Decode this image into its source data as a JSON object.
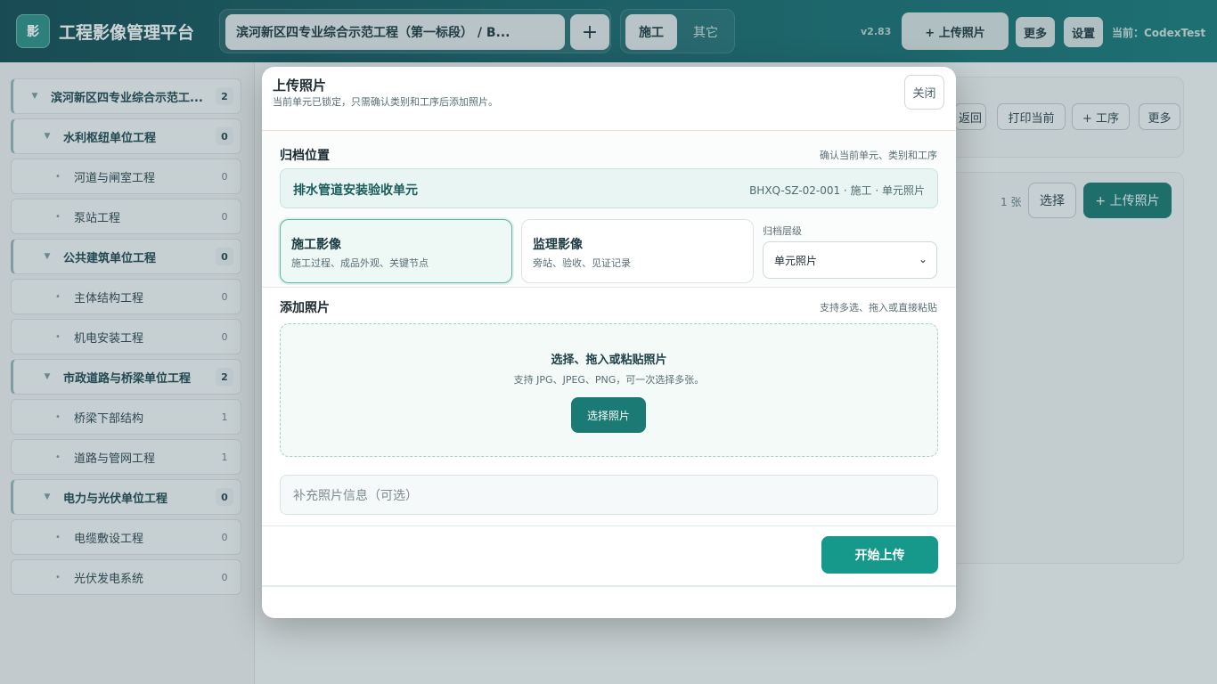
{
  "header": {
    "logo_char": "影",
    "app_title": "工程影像管理平台",
    "project_name": "滨河新区四专业综合示范工程（第一标段） / B...",
    "project_add": "+",
    "tabs": [
      {
        "label": "施工",
        "active": true
      },
      {
        "label": "其它",
        "active": false
      }
    ],
    "version": "v2.83",
    "upload_label": "+ 上传照片",
    "more_label": "更多",
    "settings_label": "设置",
    "current_user": "当前：CodexTest"
  },
  "sidebar": {
    "items": [
      {
        "label": "滨河新区四专业综合示范工...",
        "count": "2",
        "level": 0,
        "marker": "▼"
      },
      {
        "label": "水利枢纽单位工程",
        "count": "0",
        "level": 1,
        "marker": "▼"
      },
      {
        "label": "河道与闸室工程",
        "count": "0",
        "level": 2,
        "marker": "•"
      },
      {
        "label": "泵站工程",
        "count": "0",
        "level": 2,
        "marker": "•"
      },
      {
        "label": "公共建筑单位工程",
        "count": "0",
        "level": 1,
        "marker": "▼"
      },
      {
        "label": "主体结构工程",
        "count": "0",
        "level": 2,
        "marker": "•"
      },
      {
        "label": "机电安装工程",
        "count": "0",
        "level": 2,
        "marker": "•"
      },
      {
        "label": "市政道路与桥梁单位工程",
        "count": "2",
        "level": 1,
        "marker": "▼"
      },
      {
        "label": "桥梁下部结构",
        "count": "1",
        "level": 2,
        "marker": "•"
      },
      {
        "label": "道路与管网工程",
        "count": "1",
        "level": 2,
        "marker": "•"
      },
      {
        "label": "电力与光伏单位工程",
        "count": "0",
        "level": 1,
        "marker": "▼"
      },
      {
        "label": "电缆敷设工程",
        "count": "0",
        "level": 2,
        "marker": "•"
      },
      {
        "label": "光伏发电系统",
        "count": "0",
        "level": 2,
        "marker": "•"
      }
    ]
  },
  "background": {
    "toolbar": {
      "back": "返回",
      "print": "打印当前",
      "add_process": "+ 工序",
      "more": "更多"
    },
    "photo_count": "1 张",
    "select_label": "选择",
    "upload_label": "+ 上传照片"
  },
  "modal": {
    "title": "上传照片",
    "subtitle": "当前单元已锁定，只需确认类别和工序后添加照片。",
    "close_label": "关闭",
    "location": {
      "label": "归档位置",
      "hint": "确认当前单元、类别和工序",
      "unit_name": "排水管道安装验收单元",
      "unit_code": "BHXQ-SZ-02-001 · 施工 · 单元照片"
    },
    "types": [
      {
        "title": "施工影像",
        "desc": "施工过程、成品外观、关键节点",
        "selected": true
      },
      {
        "title": "监理影像",
        "desc": "旁站、验收、见证记录",
        "selected": false
      }
    ],
    "level": {
      "label": "归档层级",
      "value": "单元照片"
    },
    "add": {
      "label": "添加照片",
      "hint": "支持多选、拖入或直接粘贴",
      "drop_title": "选择、拖入或粘贴照片",
      "drop_desc": "支持 JPG、JPEG、PNG，可一次选择多张。",
      "drop_button": "选择照片"
    },
    "note_placeholder": "补充照片信息（可选）",
    "start_upload": "开始上传"
  },
  "colors": {
    "header_start": "#174f57",
    "header_end": "#1b7b7b",
    "accent": "#16998a",
    "selected_card_bg": "#eef8f5"
  }
}
